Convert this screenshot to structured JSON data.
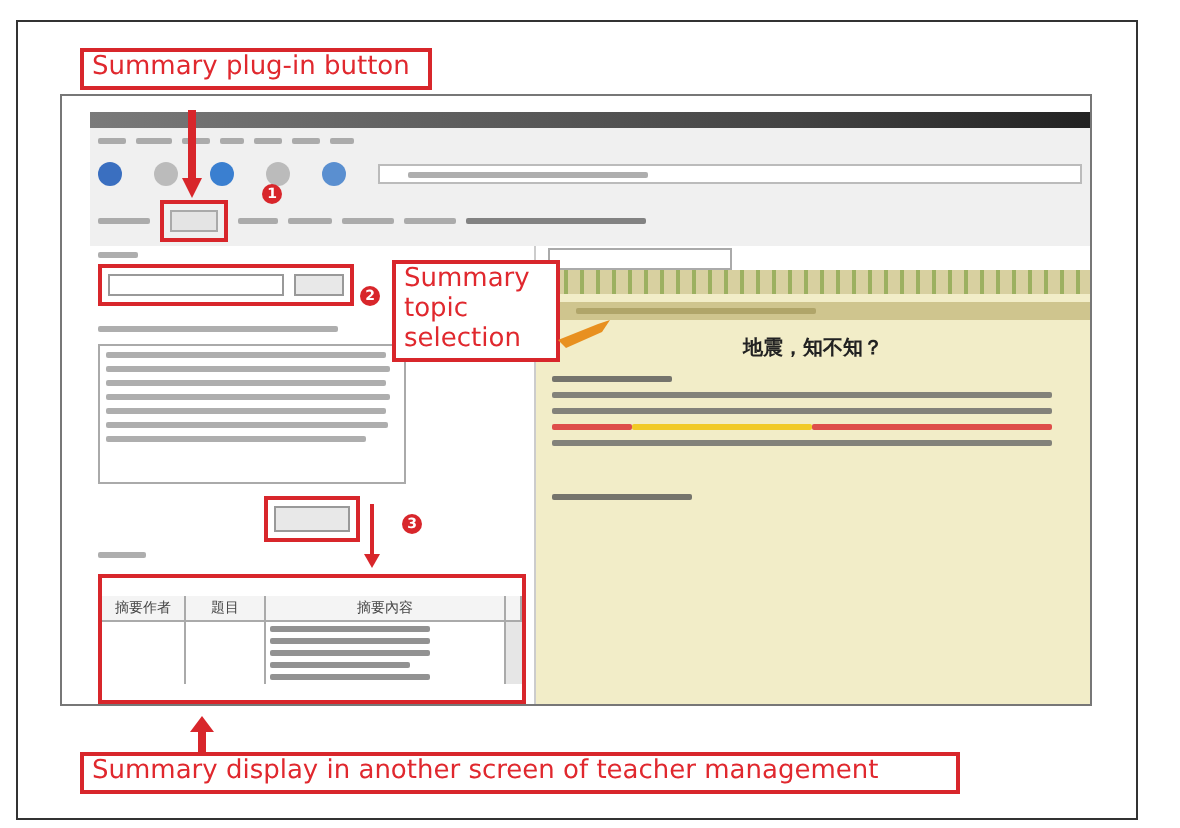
{
  "annotations": [
    {
      "text": "Summary plug-in button"
    },
    {
      "text": "Summary topic selection"
    },
    {
      "text": "Summary display in another screen of teacher management"
    }
  ],
  "markers": [
    "1",
    "2",
    "3"
  ],
  "article": {
    "title": "地震，知不知？"
  },
  "summary_table": {
    "columns": [
      "摘要作者",
      "題目",
      "摘要內容"
    ]
  }
}
